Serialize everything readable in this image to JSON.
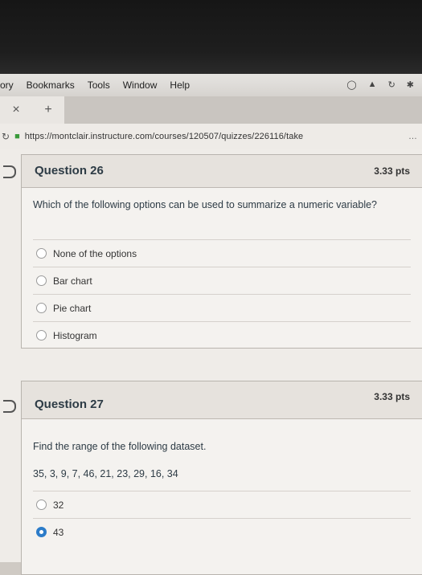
{
  "menubar": {
    "items": [
      "ory",
      "Bookmarks",
      "Tools",
      "Window",
      "Help"
    ]
  },
  "tab": {
    "close": "×",
    "new": "+"
  },
  "urlbar": {
    "url": "https://montclair.instructure.com/courses/120507/quizzes/226116/take"
  },
  "questions": [
    {
      "title": "Question 26",
      "points": "3.33 pts",
      "text": "Which of the following options can be used to summarize a numeric variable?",
      "options": [
        "None of the options",
        "Bar chart",
        "Pie chart",
        "Histogram"
      ]
    },
    {
      "title": "Question 27",
      "points": "3.33 pts",
      "text": "Find the range of the following dataset.",
      "dataset": "35, 3, 9, 7, 46, 21, 23, 29, 16, 34",
      "options": [
        "32",
        "43"
      ],
      "selected_index": 1
    }
  ]
}
